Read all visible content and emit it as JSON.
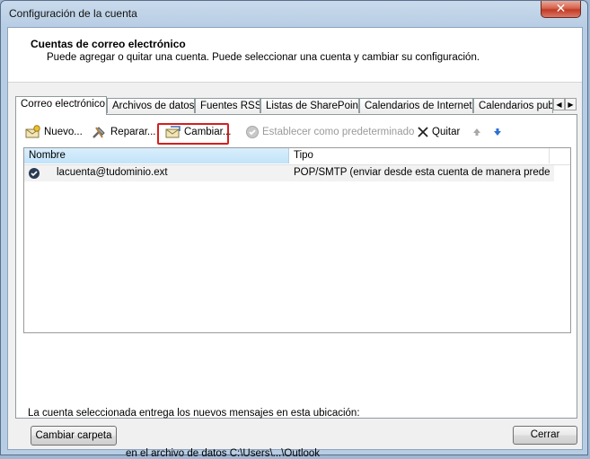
{
  "window": {
    "title": "Configuración de la cuenta",
    "close_glyph": "✕"
  },
  "header": {
    "title": "Cuentas de correo electrónico",
    "subtitle": "Puede agregar o quitar una cuenta. Puede seleccionar una cuenta y cambiar su configuración."
  },
  "tabs": [
    {
      "label": "Correo electrónico",
      "active": true
    },
    {
      "label": "Archivos de datos"
    },
    {
      "label": "Fuentes RSS"
    },
    {
      "label": "Listas de SharePoint"
    },
    {
      "label": "Calendarios de Internet"
    },
    {
      "label": "Calendarios publi"
    }
  ],
  "toolbar": {
    "nuevo": "Nuevo...",
    "reparar": "Reparar...",
    "cambiar": "Cambiar...",
    "establecer": "Establecer como predeterminado",
    "quitar": "Quitar"
  },
  "list": {
    "columns": [
      "Nombre",
      "Tipo"
    ],
    "rows": [
      {
        "name": "lacuenta@tudominio.ext",
        "type": "POP/SMTP (enviar desde esta cuenta de manera predet..."
      }
    ]
  },
  "footer": {
    "info": "La cuenta seleccionada entrega los nuevos mensajes en esta ubicación:",
    "change_folder": "Cambiar carpeta",
    "path": "en el archivo de datos C:\\Users\\...\\Outlook",
    "close": "Cerrar"
  },
  "colors": {
    "highlight": "#d41f1f",
    "selected_header": "#c2e3f9",
    "close_red": "#c33a22"
  }
}
